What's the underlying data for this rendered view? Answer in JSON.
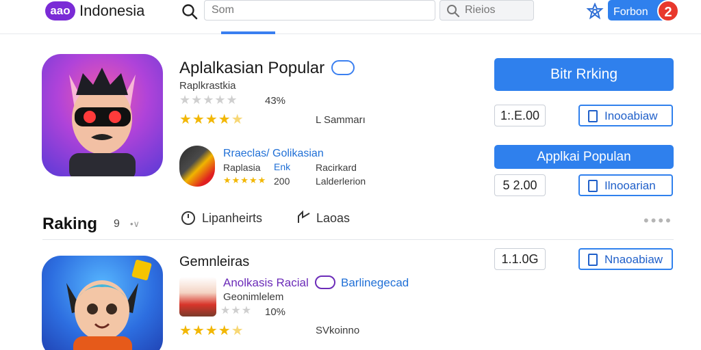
{
  "header": {
    "logo_badge": "aao",
    "logo_text": "Indonesia",
    "search_placeholder": "Som",
    "search2_placeholder": "Rieios",
    "forum_button": "Forbon",
    "notification_count": "2"
  },
  "featured": {
    "title": "Aplalkasian Popular",
    "developer": "Raplkrastkia",
    "rating_percent": "43%",
    "stars_gray": 5,
    "stars_gold": 4.5,
    "label": "L Sammarı",
    "primary_button": "Bitr Rrking",
    "price": "1:.E.00",
    "install_label": "Inooabiaw"
  },
  "second_app": {
    "title": "Rraeclas/ Golikasian",
    "dev_left": "Raplasia",
    "dev_left_link": "Enk",
    "dev_right": "Racirkard",
    "stars": 4.5,
    "rating_count": "200",
    "right_label": "Lalderlerion",
    "primary_button": "Applkai Populan",
    "price": "5 2.00",
    "install_label": "Ilnooarian"
  },
  "ranking_section": {
    "title": "Raking",
    "count": "9",
    "action1": "Lipanheirts",
    "action2": "Laoas"
  },
  "third_app": {
    "heading": "Gemnleiras",
    "name": "Anolkasis Racial",
    "tag": "Barlinegecad",
    "developer": "Geonimlelem",
    "rating_percent": "10%",
    "stars_gold": 4.5,
    "label": "SVkoinno",
    "price": "1.1.0G",
    "install_label": "Nnaoabiaw"
  },
  "colors": {
    "accent": "#2f80ed",
    "brand": "#7a2bd6",
    "badge": "#e8382c",
    "star": "#f2b705"
  }
}
